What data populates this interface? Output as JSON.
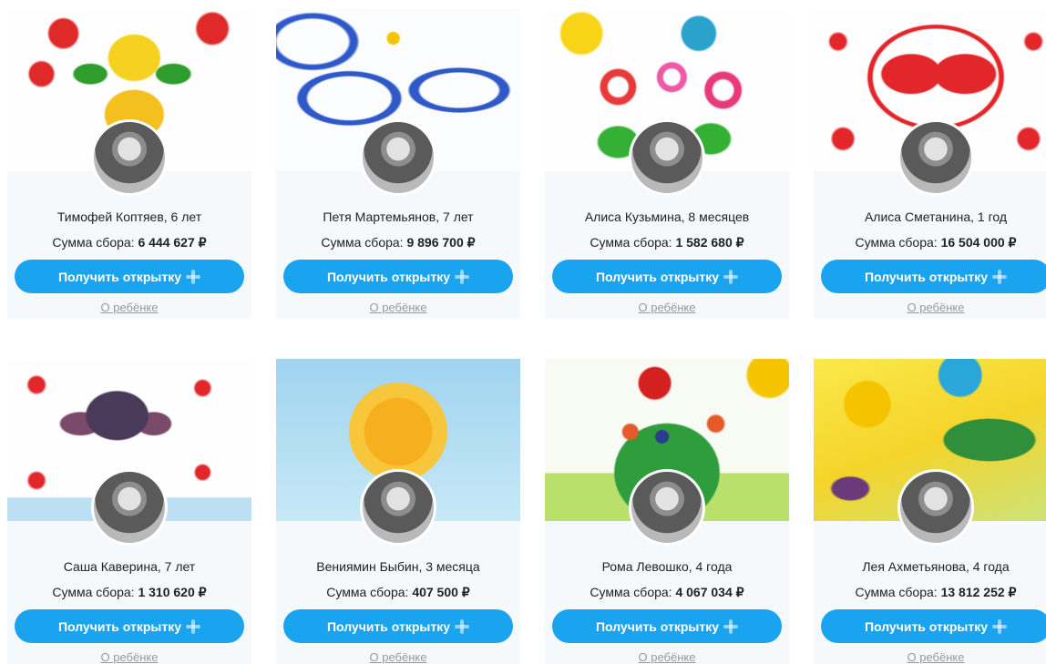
{
  "button_label": "Получить открытку",
  "about_label": "О ребёнке",
  "sum_label": "Сумма сбора:",
  "cards": [
    {
      "name": "Тимофей Коптяев, 6 лет",
      "sum": "6 444 627 ₽"
    },
    {
      "name": "Петя Мартемьянов, 7 лет",
      "sum": "9 896 700 ₽"
    },
    {
      "name": "Алиса Кузьмина, 8 месяцев",
      "sum": "1 582 680 ₽"
    },
    {
      "name": "Алиса Сметанина, 1 год",
      "sum": "16 504 000 ₽"
    },
    {
      "name": "Саша Каверина, 7 лет",
      "sum": "1 310 620 ₽"
    },
    {
      "name": "Вениямин Быбин, 3 месяца",
      "sum": "407 500 ₽"
    },
    {
      "name": "Рома Левошко, 4 года",
      "sum": "4 067 034 ₽"
    },
    {
      "name": "Лея Ахметьянова, 4 года",
      "sum": "13 812 252 ₽"
    }
  ]
}
